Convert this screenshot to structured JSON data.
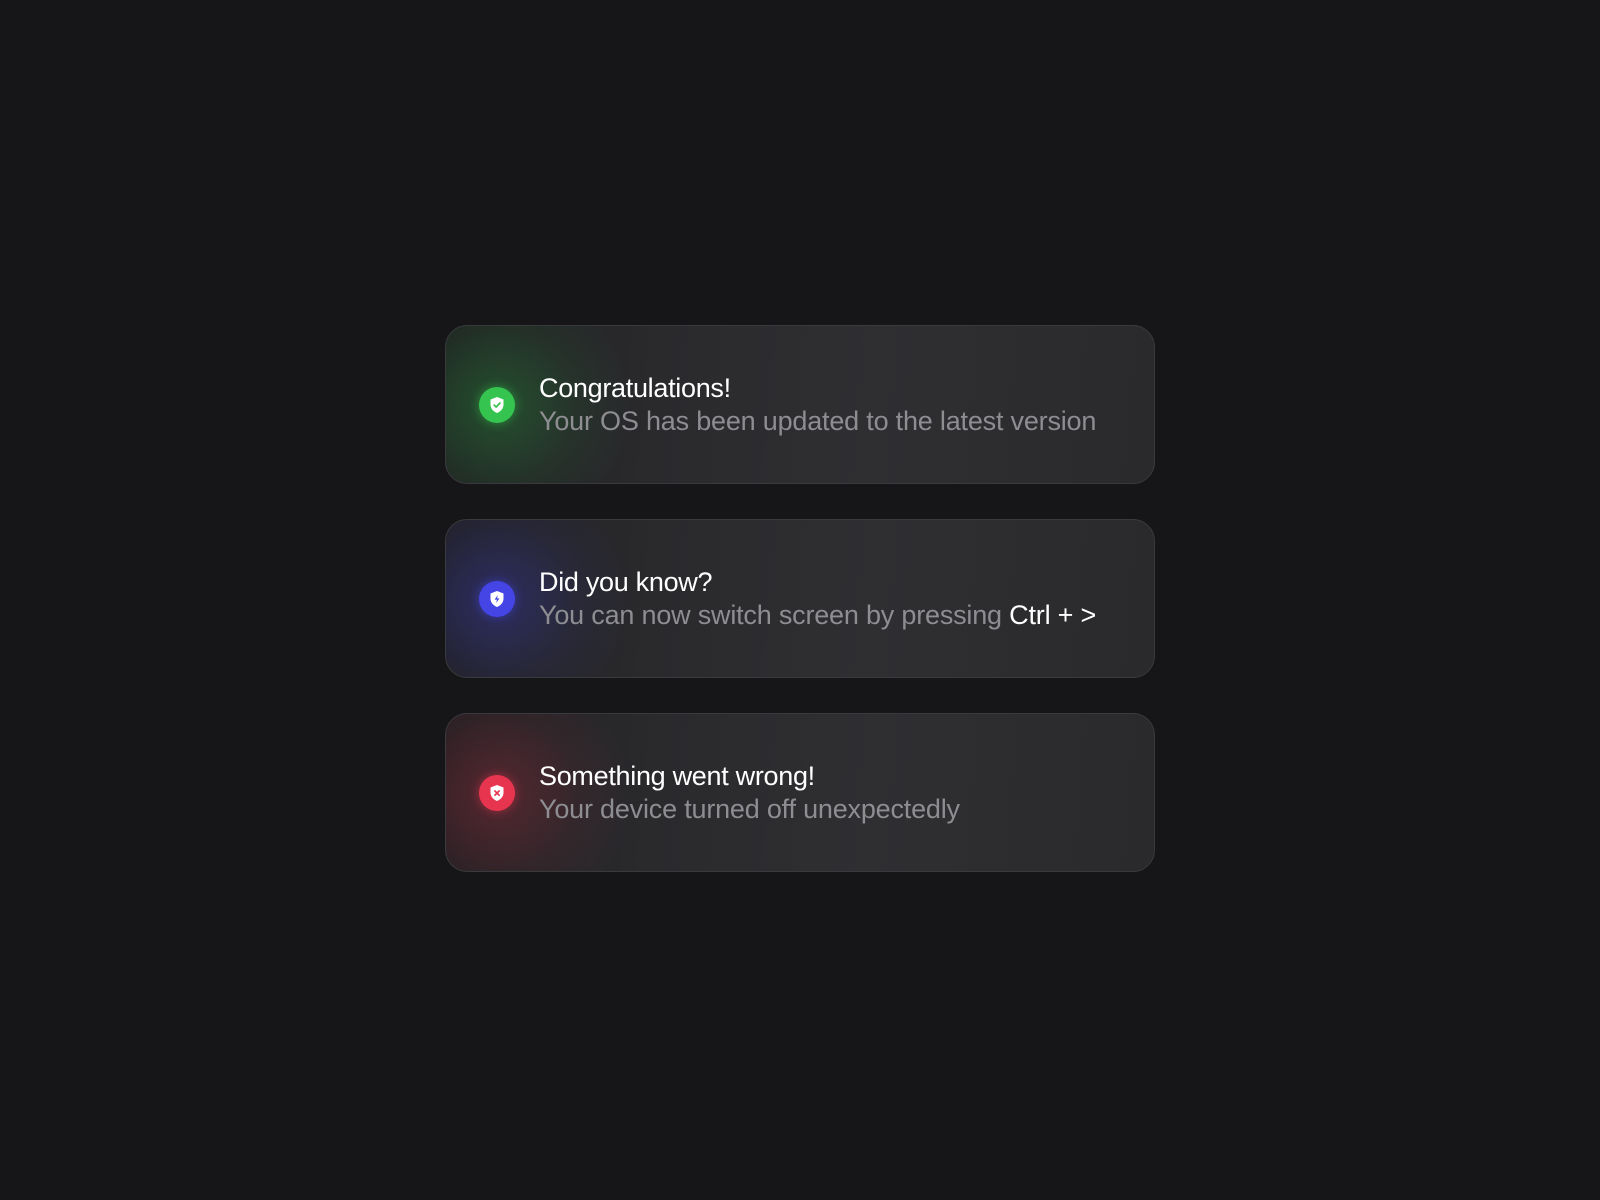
{
  "colors": {
    "background": "#161618",
    "success": "#34c44f",
    "info": "#4545e6",
    "error": "#e8354f",
    "title_text": "#ffffff",
    "message_text": "#8d8d92"
  },
  "notifications": [
    {
      "type": "success",
      "icon": "shield-check-icon",
      "title": "Congratulations!",
      "message": "Your OS has been updated to the latest version"
    },
    {
      "type": "info",
      "icon": "shield-bolt-icon",
      "title": "Did you know?",
      "message": "You can now switch screen by pressing",
      "shortcut": "Ctrl + >"
    },
    {
      "type": "error",
      "icon": "shield-x-icon",
      "title": "Something went wrong!",
      "message": "Your device turned off unexpectedly"
    }
  ]
}
